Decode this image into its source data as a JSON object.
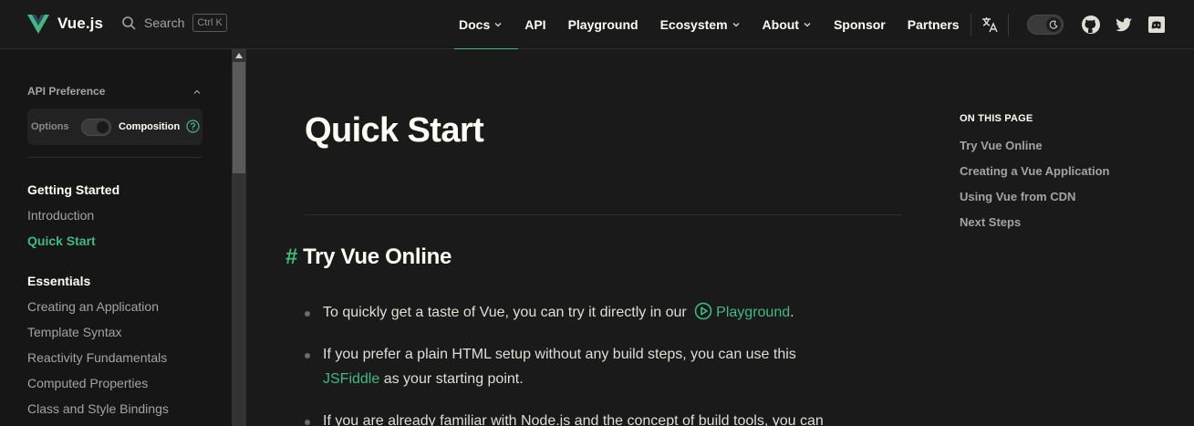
{
  "nav": {
    "logo_text": "Vue.js",
    "search_label": "Search",
    "search_shortcut": "Ctrl K",
    "links": [
      {
        "label": "Docs",
        "dropdown": true,
        "active": true
      },
      {
        "label": "API",
        "dropdown": false,
        "active": false
      },
      {
        "label": "Playground",
        "dropdown": false,
        "active": false
      },
      {
        "label": "Ecosystem",
        "dropdown": true,
        "active": false
      },
      {
        "label": "About",
        "dropdown": true,
        "active": false
      },
      {
        "label": "Sponsor",
        "dropdown": false,
        "active": false
      },
      {
        "label": "Partners",
        "dropdown": false,
        "active": false
      }
    ],
    "icons": [
      "translate-icon",
      "theme-toggle",
      "github-icon",
      "twitter-icon",
      "discord-icon"
    ]
  },
  "sidebar": {
    "api_preference_title": "API Preference",
    "options_label": "Options",
    "composition_label": "Composition",
    "groups": [
      {
        "title": "Getting Started",
        "items": [
          {
            "label": "Introduction",
            "active": false
          },
          {
            "label": "Quick Start",
            "active": true
          }
        ]
      },
      {
        "title": "Essentials",
        "items": [
          {
            "label": "Creating an Application",
            "active": false
          },
          {
            "label": "Template Syntax",
            "active": false
          },
          {
            "label": "Reactivity Fundamentals",
            "active": false
          },
          {
            "label": "Computed Properties",
            "active": false
          },
          {
            "label": "Class and Style Bindings",
            "active": false
          }
        ]
      }
    ]
  },
  "main": {
    "title": "Quick Start",
    "section_hash": "#",
    "section_title": "Try Vue Online",
    "bullets": [
      {
        "text_before": "To quickly get a taste of Vue, you can try it directly in our",
        "link": "Playground",
        "text_after": "."
      },
      {
        "text_before": "If you prefer a plain HTML setup without any build steps, you can use this",
        "link": "JSFiddle",
        "text_after": "as your starting point."
      },
      {
        "text_before": "If you are already familiar with Node.js and the concept of build tools, you can",
        "link": "",
        "text_after": ""
      }
    ]
  },
  "aside": {
    "title": "ON THIS PAGE",
    "items": [
      "Try Vue Online",
      "Creating a Vue Application",
      "Using Vue from CDN",
      "Next Steps"
    ]
  },
  "colors": {
    "accent": "#42b883",
    "background": "#1a1a1a",
    "sidebar_background": "#161616",
    "text": "#fffff5",
    "muted_text": "#a3a3a3"
  }
}
